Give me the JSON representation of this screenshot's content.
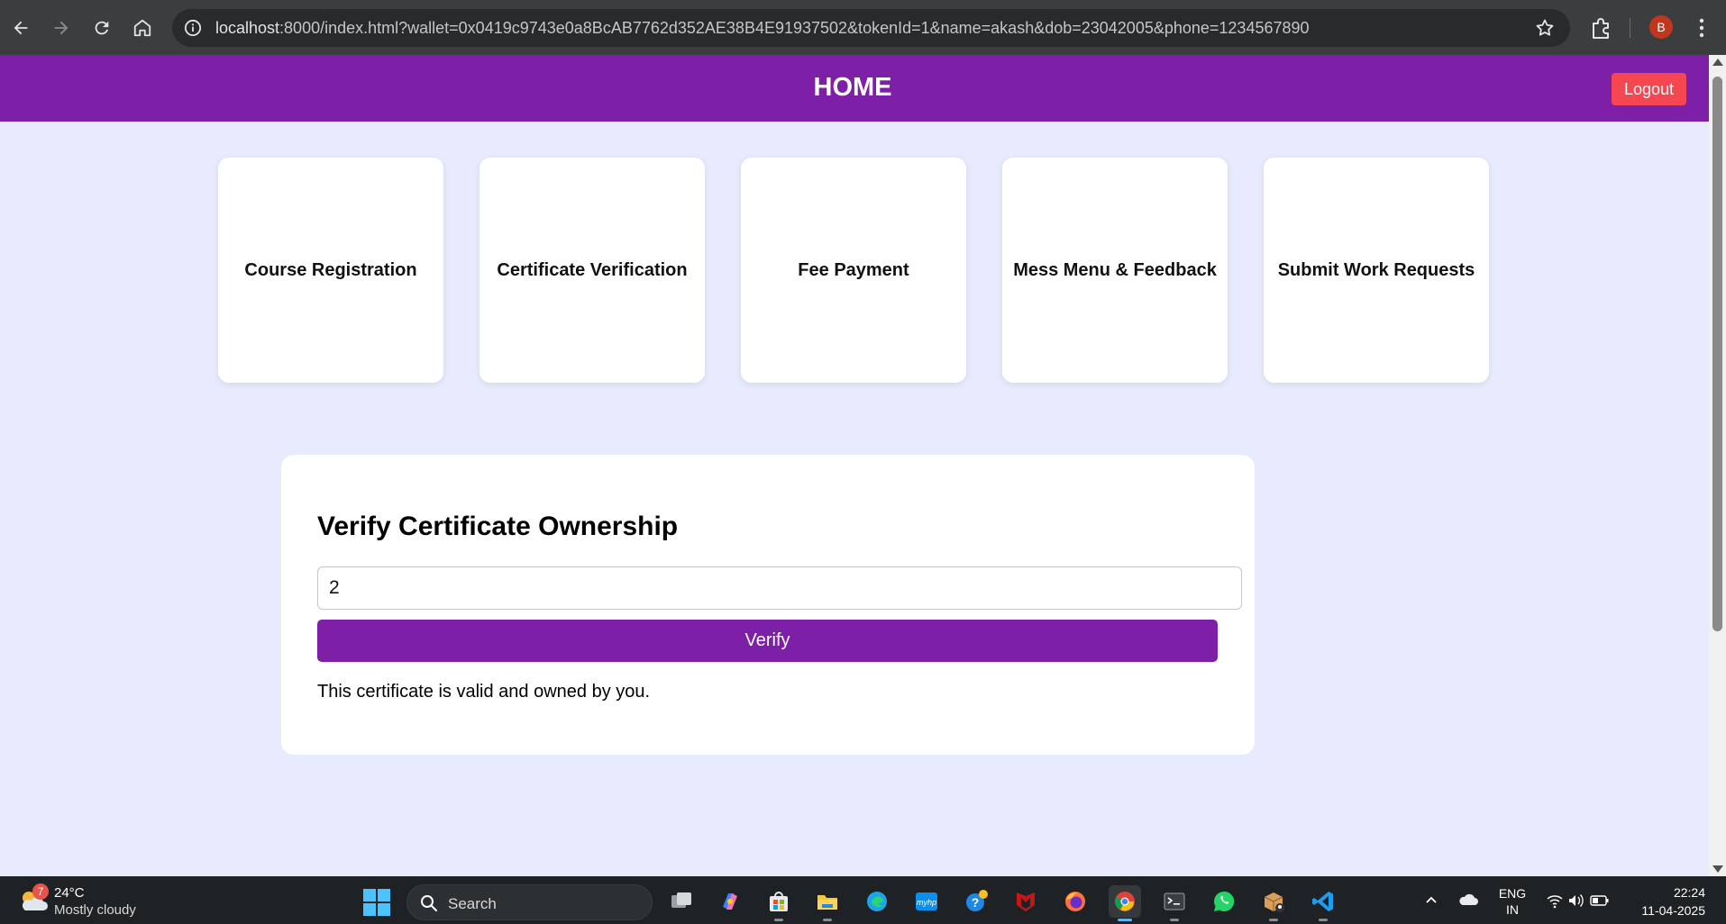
{
  "browser": {
    "url_host": "localhost",
    "url_rest": ":8000/index.html?wallet=0x0419c9743e0a8BcAB7762d352AE38B4E91937502&tokenId=1&name=akash&dob=23042005&phone=1234567890",
    "profile_initial": "B"
  },
  "header": {
    "title": "HOME",
    "logout_label": "Logout"
  },
  "cards": [
    {
      "label": "Course Registration"
    },
    {
      "label": "Certificate Verification"
    },
    {
      "label": "Fee Payment"
    },
    {
      "label": "Mess Menu & Feedback"
    },
    {
      "label": "Submit Work Requests"
    }
  ],
  "verify": {
    "heading": "Verify Certificate Ownership",
    "input_value": "2",
    "button_label": "Verify",
    "result": "This certificate is valid and owned by you."
  },
  "taskbar": {
    "weather_temp": "24°C",
    "weather_desc": "Mostly cloudy",
    "weather_badge": "7",
    "search_label": "Search",
    "lang_line1": "ENG",
    "lang_line2": "IN",
    "time": "22:24",
    "date": "11-04-2025"
  },
  "colors": {
    "accent": "#7e1fa8",
    "logout": "#f44752",
    "page_bg": "#e8eafd"
  }
}
